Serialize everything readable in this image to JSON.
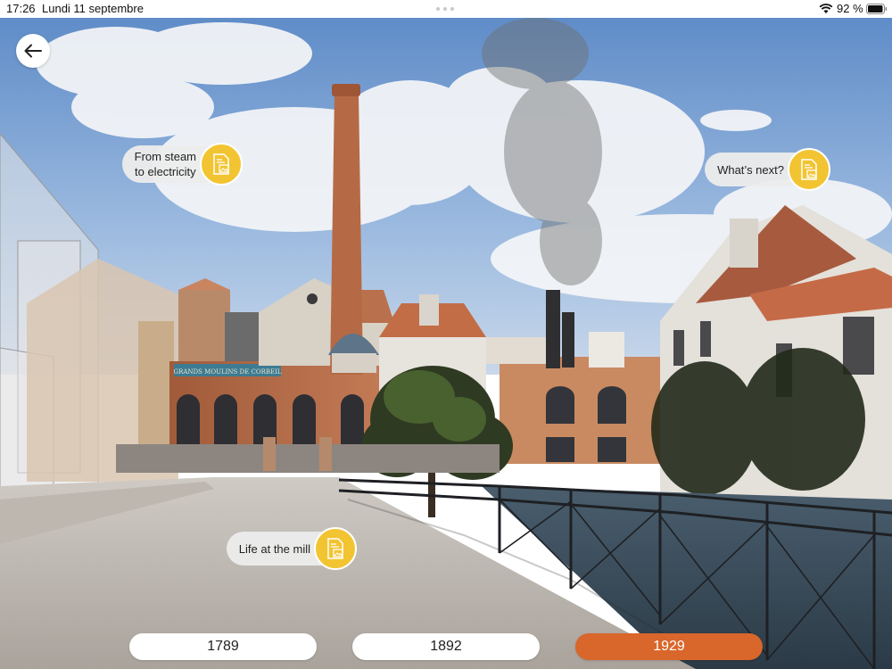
{
  "status_bar": {
    "time": "17:26",
    "date": "Lundi 11 septembre",
    "battery": "92 %"
  },
  "icons": {
    "back": "arrow-left-icon",
    "hotspot": "document-image-icon",
    "wifi": "wifi-icon",
    "battery": "battery-icon"
  },
  "hotspots": {
    "steam_line1": "From steam",
    "steam_line2": "to electricity",
    "next": "What’s next?",
    "life": "Life at the mill"
  },
  "timeline": {
    "years": [
      "1789",
      "1892",
      "1929"
    ],
    "selected": "1929"
  },
  "scene": {
    "sign_text": "GRANDS MOULINS DE CORBEIL"
  },
  "colors": {
    "accent_orange": "#d9662a",
    "hotspot_yellow": "#f3c431",
    "sky": "#7aa3d6"
  }
}
